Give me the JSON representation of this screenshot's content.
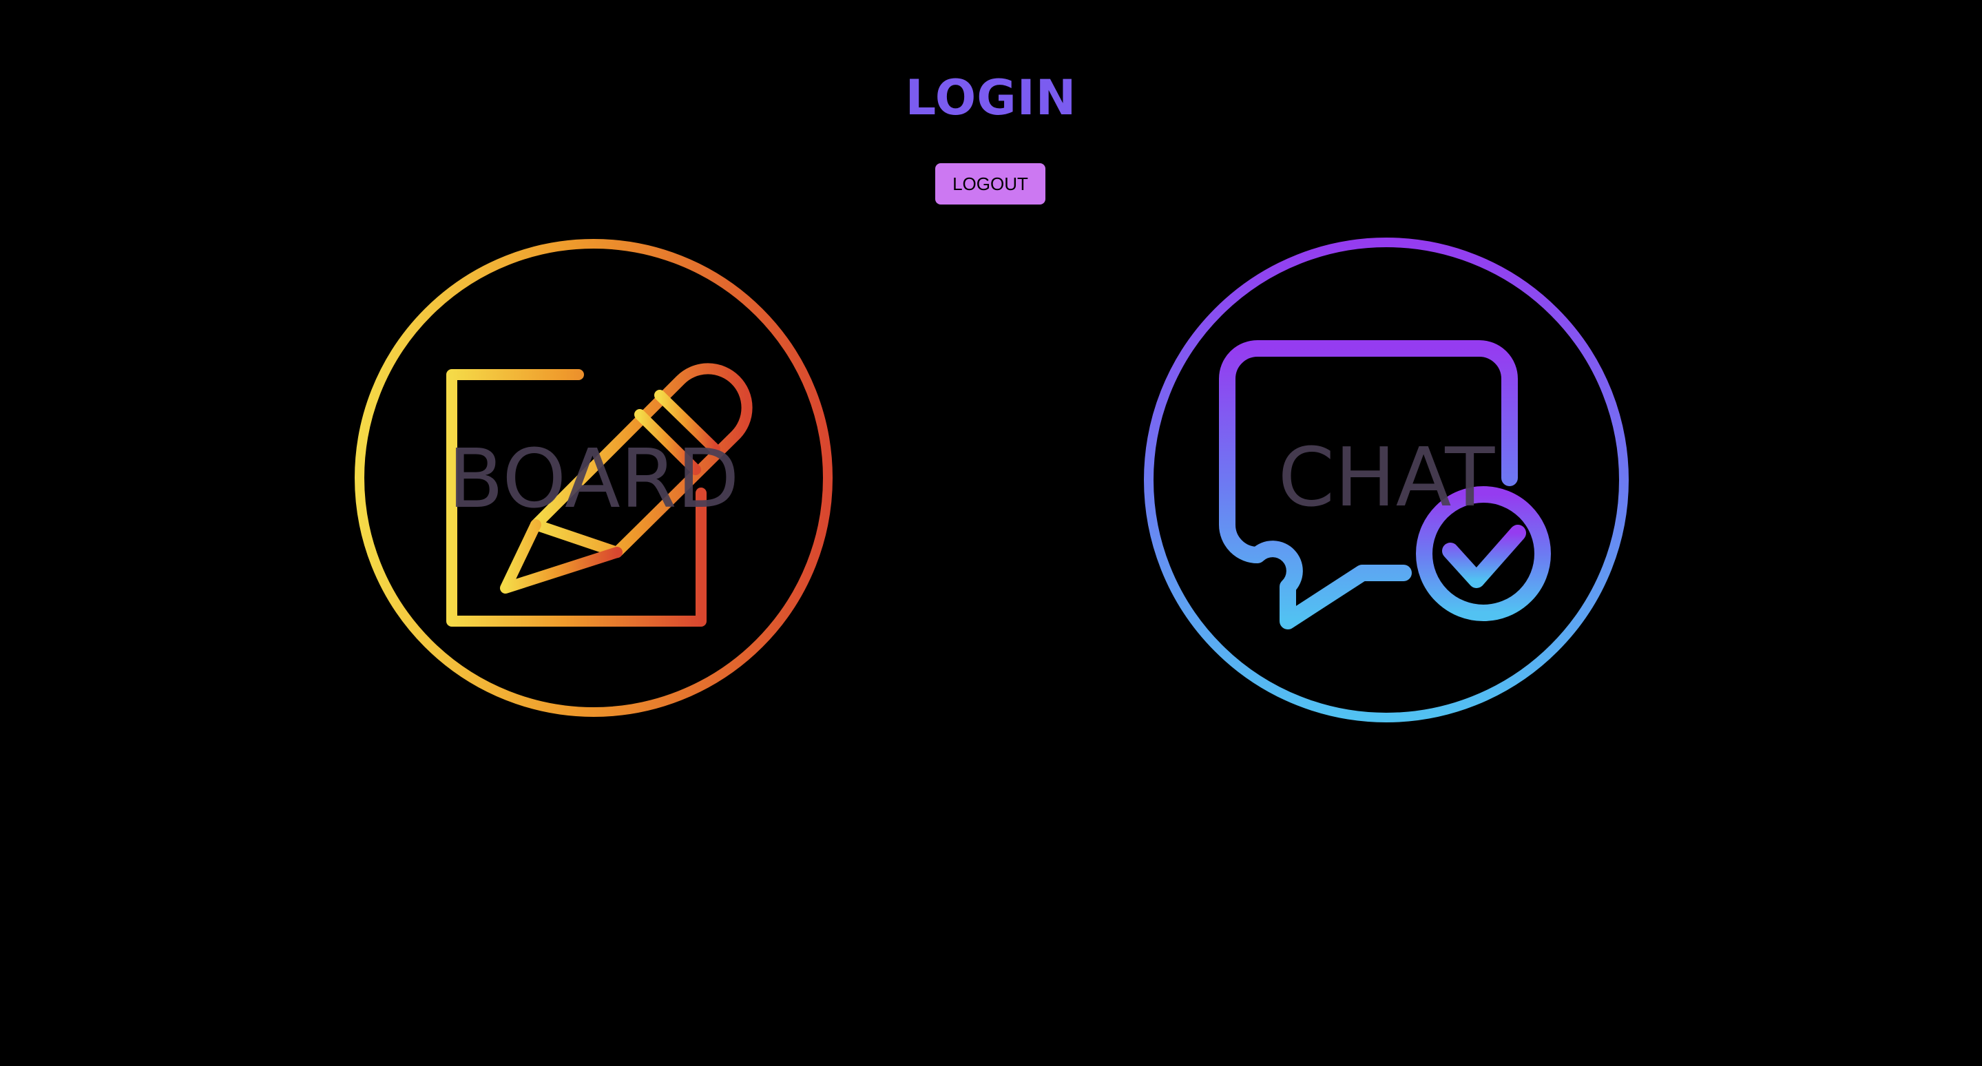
{
  "header": {
    "title": "LOGIN",
    "title_color": "#7b5cf0",
    "logout_label": "LOGOUT",
    "logout_color": "#cc78f2"
  },
  "tiles": [
    {
      "label": "BOARD",
      "icon": "pencil-on-paper-icon",
      "gradient": [
        "#f5da48",
        "#ef9b2c",
        "#d9472f"
      ]
    },
    {
      "label": "CHAT",
      "icon": "chat-bubble-check-icon",
      "gradient": [
        "#953cf0",
        "#6d7af2",
        "#52c2f2"
      ]
    }
  ]
}
